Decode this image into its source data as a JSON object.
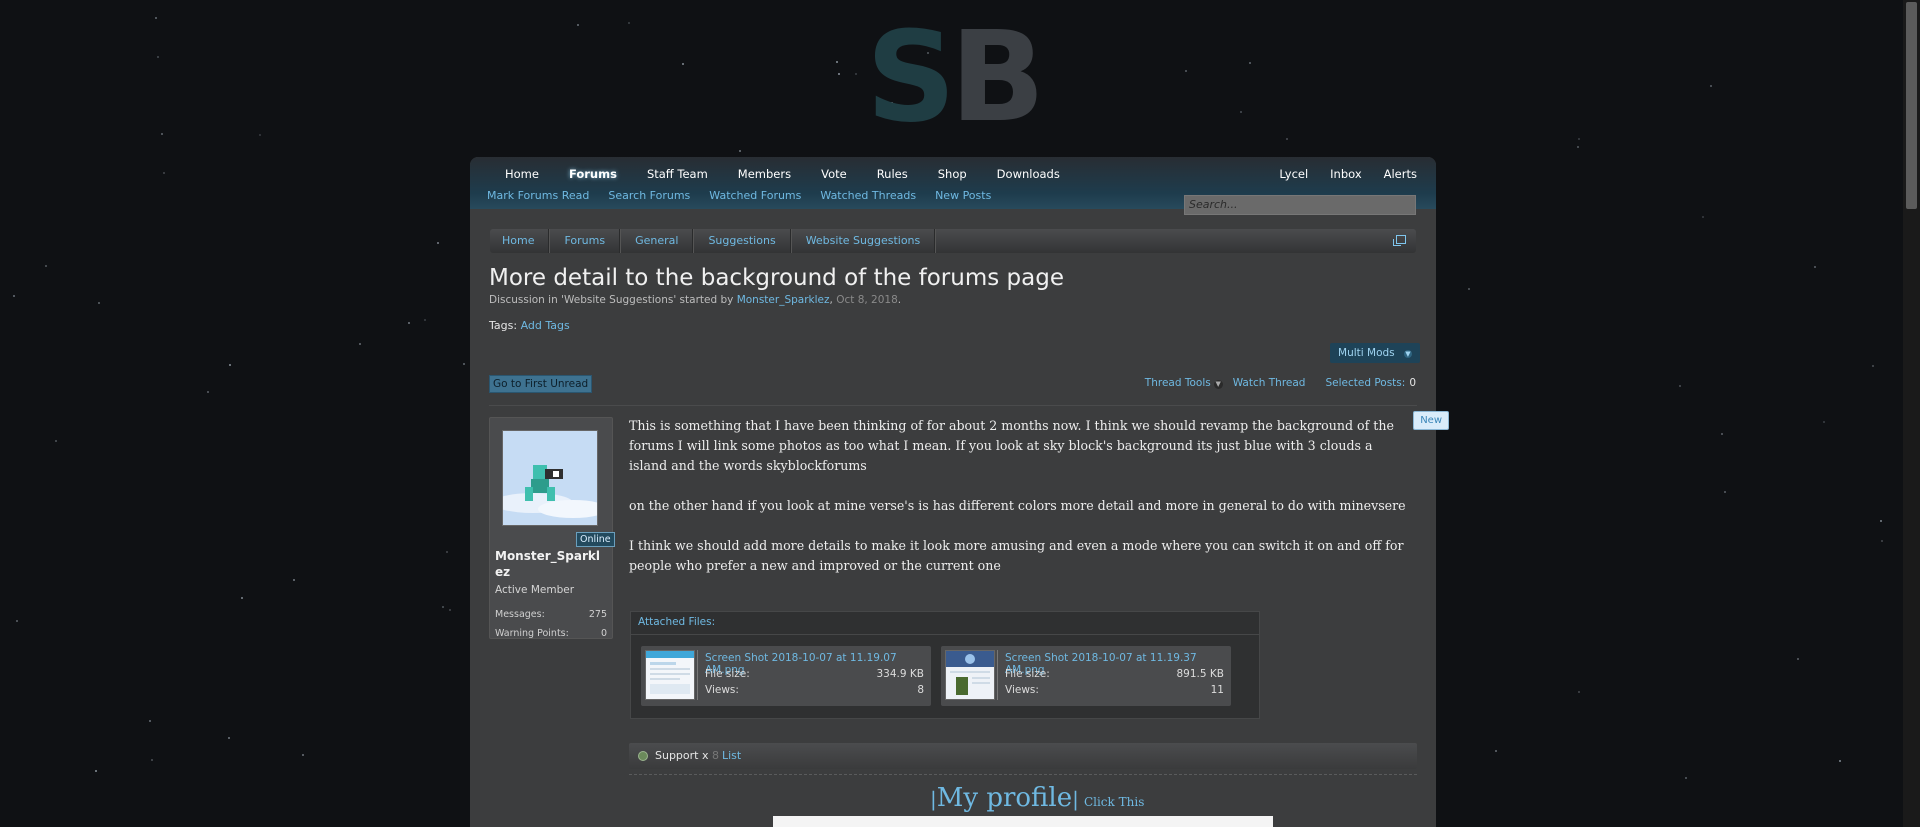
{
  "logo": {
    "s": "S",
    "b": "B"
  },
  "nav": {
    "tabs": [
      "Home",
      "Forums",
      "Staff Team",
      "Members",
      "Vote",
      "Rules",
      "Shop",
      "Downloads"
    ],
    "active": "Forums",
    "right": [
      "Lycel",
      "Inbox",
      "Alerts"
    ],
    "sub": [
      "Mark Forums Read",
      "Search Forums",
      "Watched Forums",
      "Watched Threads",
      "New Posts"
    ],
    "search_placeholder": "Search..."
  },
  "breadcrumb": [
    "Home",
    "Forums",
    "General",
    "Suggestions",
    "Website Suggestions"
  ],
  "thread": {
    "title": "More detail to the background of the forums page",
    "meta_prefix": "Discussion in 'Website Suggestions' started by ",
    "author": "Monster_Sparklez",
    "date": "Oct 8, 2018",
    "tags_label": "Tags:",
    "add_tags": "Add Tags",
    "multi_mods": "Multi Mods",
    "go_first_unread": "Go to First Unread",
    "thread_tools": "Thread Tools",
    "watch_thread": "Watch Thread",
    "selected_posts_label": "Selected Posts:",
    "selected_posts_count": "0"
  },
  "user": {
    "online": "Online",
    "name": "Monster_Sparklez",
    "title": "Active Member",
    "messages_label": "Messages:",
    "messages": "275",
    "warning_label": "Warning Points:",
    "warning": "0"
  },
  "post": {
    "paragraphs": [
      "This is something that I have been thinking of for about 2 months now. I think we should revamp the background of the forums I will link some photos as too what I mean. If you look at sky block's background its just blue with 3 clouds a island and the words skyblockforums",
      "on the other hand if you look at mine verse's is has different colors more detail and more in general to do with minevsere",
      "I think we should add more details to make it look more amusing and even a mode where you can switch it on and off for people who prefer a new and improved or the current one"
    ],
    "new_badge": "New",
    "attached_label": "Attached Files:",
    "files": [
      {
        "name": "Screen Shot 2018-10-07 at 11.19.07 AM.png",
        "size_label": "File size:",
        "size": "334.9 KB",
        "views_label": "Views:",
        "views": "8"
      },
      {
        "name": "Screen Shot 2018-10-07 at 11.19.37 AM.png",
        "size_label": "File size:",
        "size": "891.5 KB",
        "views_label": "Views:",
        "views": "11"
      }
    ],
    "reaction": "Support x",
    "reaction_count": "8",
    "list": "List"
  },
  "signature": {
    "bar": "|",
    "profile": "My profile",
    "click": "Click This"
  },
  "colors": {
    "accent": "#6fb9e2",
    "nav": "#1e3c4d",
    "panel": "#3c3d3e"
  }
}
